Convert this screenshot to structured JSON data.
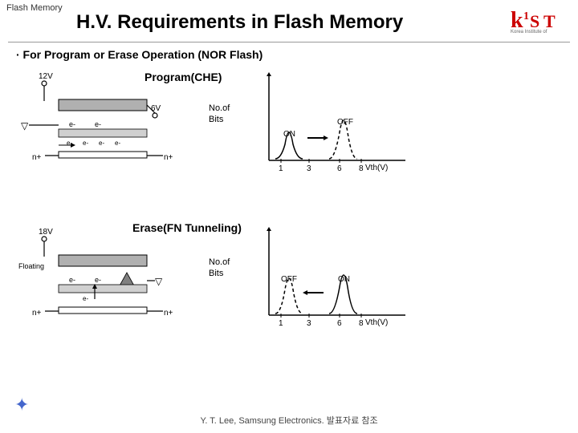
{
  "header": {
    "tab_label": "Flash Memory",
    "main_title": "H.V. Requirements in Flash Memory"
  },
  "subtitle": "· For Program or Erase Operation (NOR Flash)",
  "program": {
    "label": "Program(CHE)",
    "voltage_top": "12V",
    "voltage_mid": "6V",
    "no_of_bits": "No.of",
    "bits": "Bits",
    "on_label": "ON",
    "off_label": "OFF",
    "vth_label": "Vth(V)",
    "x_axis": [
      "1",
      "3",
      "6",
      "8"
    ]
  },
  "erase": {
    "label": "Erase(FN Tunneling)",
    "voltage_top": "18V",
    "floating_label": "Floating",
    "no_of_bits": "No.of",
    "bits": "Bits",
    "on_label": "ON",
    "off_label": "OFF",
    "vth_label": "Vth(V)",
    "x_axis": [
      "1",
      "3",
      "6",
      "8"
    ]
  },
  "footer": {
    "text": "Y. T. Lee, Samsung Electronics. 발표자료 참조"
  },
  "icons": {
    "arrow_right": "→",
    "arrow_left": "←",
    "star": "✦"
  }
}
